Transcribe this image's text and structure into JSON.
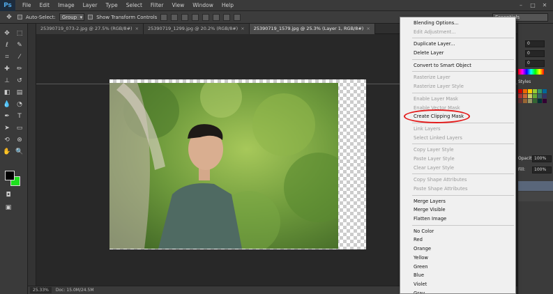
{
  "app": {
    "logo": "Ps"
  },
  "menubar": {
    "items": [
      "File",
      "Edit",
      "Image",
      "Layer",
      "Type",
      "Select",
      "Filter",
      "View",
      "Window",
      "Help"
    ]
  },
  "options": {
    "auto_select_label": "Auto-Select:",
    "auto_select_value": "Group",
    "transform_label": "Show Transform Controls",
    "workspace": "Essentials"
  },
  "tabs": [
    {
      "label": "25390719_073-2.jpg @ 27.5% (RGB/8#)"
    },
    {
      "label": "25390719_1299.jpg @ 20.2% (RGB/8#)"
    },
    {
      "label": "25390719_1579.jpg @ 25.3% (Layer 1, RGB/8#)"
    }
  ],
  "status": {
    "zoom": "25.33%",
    "doc": "Doc: 15.0M/24.5M"
  },
  "right_panel": {
    "values": [
      "0",
      "0",
      "0"
    ],
    "styles_label": "Styles",
    "opacity_label": "Opacity:",
    "opacity_value": "100%",
    "fill_label": "Fill:",
    "fill_value": "100%"
  },
  "context_menu": {
    "items": [
      {
        "label": "Blending Options...",
        "disabled": false
      },
      {
        "label": "Edit Adjustment...",
        "disabled": true
      },
      {
        "sep": true
      },
      {
        "label": "Duplicate Layer...",
        "disabled": false
      },
      {
        "label": "Delete Layer",
        "disabled": false
      },
      {
        "sep": true
      },
      {
        "label": "Convert to Smart Object",
        "disabled": false
      },
      {
        "sep": true
      },
      {
        "label": "Rasterize Layer",
        "disabled": true
      },
      {
        "label": "Rasterize Layer Style",
        "disabled": true
      },
      {
        "sep": true
      },
      {
        "label": "Enable Layer Mask",
        "disabled": true
      },
      {
        "label": "Enable Vector Mask",
        "disabled": true
      },
      {
        "label": "Create Clipping Mask",
        "disabled": false,
        "highlighted": true
      },
      {
        "sep": true
      },
      {
        "label": "Link Layers",
        "disabled": true
      },
      {
        "label": "Select Linked Layers",
        "disabled": true
      },
      {
        "sep": true
      },
      {
        "label": "Copy Layer Style",
        "disabled": true
      },
      {
        "label": "Paste Layer Style",
        "disabled": true
      },
      {
        "label": "Clear Layer Style",
        "disabled": true
      },
      {
        "sep": true
      },
      {
        "label": "Copy Shape Attributes",
        "disabled": true
      },
      {
        "label": "Paste Shape Attributes",
        "disabled": true
      },
      {
        "sep": true
      },
      {
        "label": "Merge Layers",
        "disabled": false
      },
      {
        "label": "Merge Visible",
        "disabled": false
      },
      {
        "label": "Flatten Image",
        "disabled": false
      },
      {
        "sep": true
      },
      {
        "label": "No Color",
        "disabled": false
      },
      {
        "label": "Red",
        "disabled": false
      },
      {
        "label": "Orange",
        "disabled": false
      },
      {
        "label": "Yellow",
        "disabled": false
      },
      {
        "label": "Green",
        "disabled": false
      },
      {
        "label": "Blue",
        "disabled": false
      },
      {
        "label": "Violet",
        "disabled": false
      },
      {
        "label": "Gray",
        "disabled": false
      }
    ]
  },
  "colors": {
    "foreground": "#000000",
    "background": "#1ee01e",
    "highlight_ring": "#e41b1b"
  }
}
